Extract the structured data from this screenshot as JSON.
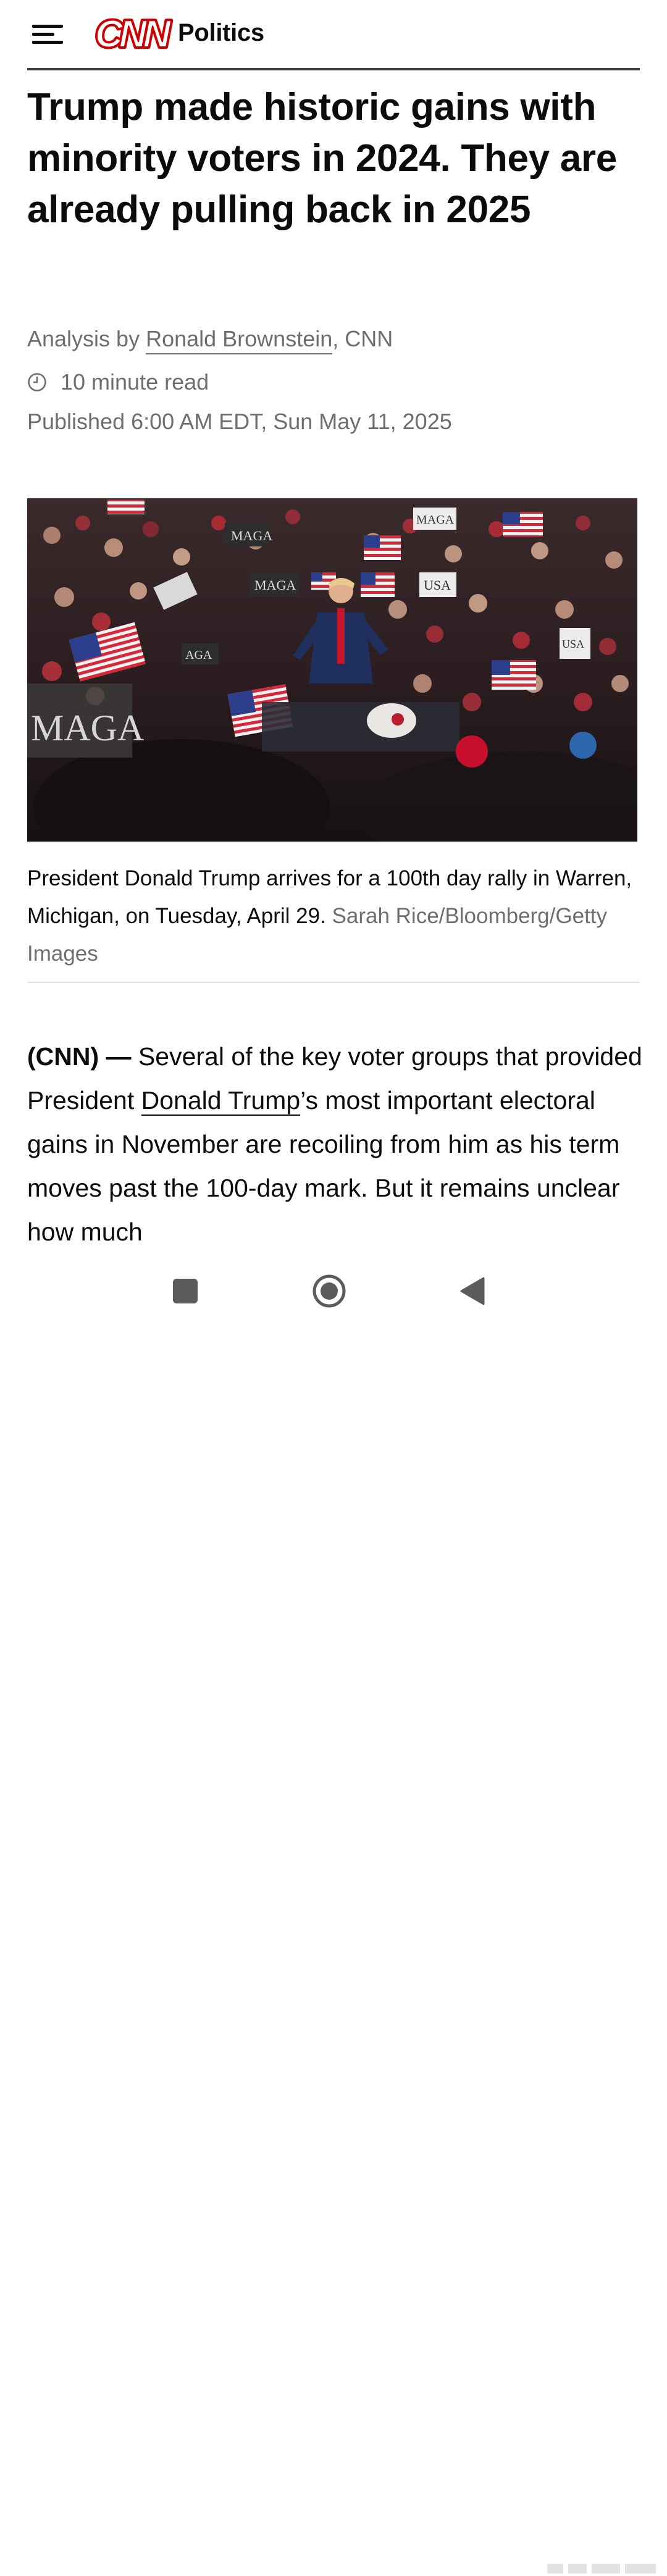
{
  "header": {
    "menu_icon": "hamburger-menu-icon",
    "logo_text": "CNN",
    "section": "Politics",
    "brand_color": "#cc0000"
  },
  "article": {
    "headline": "Trump made historic gains with minority voters in 2024. They are already pulling back in 2025",
    "byline_prefix": "Analysis by ",
    "author": "Ronald Brownstein",
    "byline_suffix": ", CNN",
    "read_time": "10 minute read",
    "published": "Published 6:00 AM EDT, Sun May 11, 2025"
  },
  "photo": {
    "signs": [
      "MAGA",
      "MAGA",
      "MAGA",
      "USA",
      "USA",
      "AGA",
      "MAGA",
      "USA"
    ]
  },
  "caption": {
    "text": "President Donald Trump arrives for a 100th day rally in Warren, Michigan, on Tuesday, April 29.",
    "credit": "Sarah Rice/Bloomberg/Getty Images"
  },
  "body": {
    "dateline": "(CNN) —",
    "text_before_link": " Several of the key voter groups that provided President ",
    "link_text": "Donald Trump",
    "text_after_link": "’s most important electoral gains in November are recoiling from him as his term moves past the 100-day mark. But it remains unclear how much"
  },
  "navbar": {
    "recents_icon": "recents-square-icon",
    "home_icon": "home-circle-icon",
    "back_icon": "back-triangle-icon"
  }
}
